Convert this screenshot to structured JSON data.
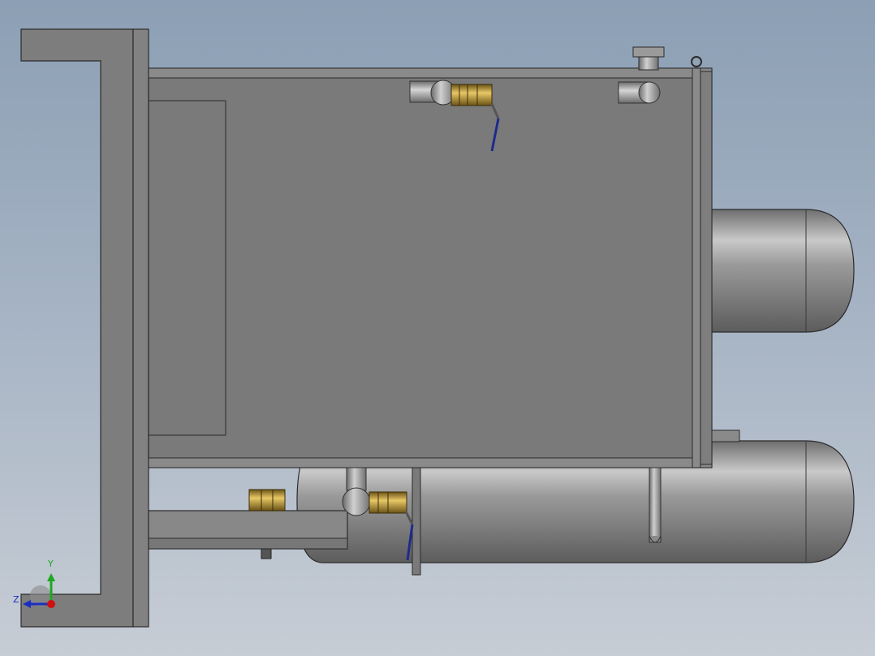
{
  "viewport": {
    "background_top": "#8c9fb4",
    "background_bottom": "#c7cdd5"
  },
  "model": {
    "frame_color": "#7d7d7d",
    "tank_color": "#7a7a7a",
    "cylinder_color": "#8a8a8a",
    "motor_color": "#3f8e85",
    "valve_color": "#b89a3b",
    "handle_color": "#1e2a8c"
  },
  "triad": {
    "y_label": "Y",
    "z_label": "Z",
    "y_color": "#1ea81e",
    "z_color": "#1a2fc0",
    "x_color": "#d01010"
  }
}
